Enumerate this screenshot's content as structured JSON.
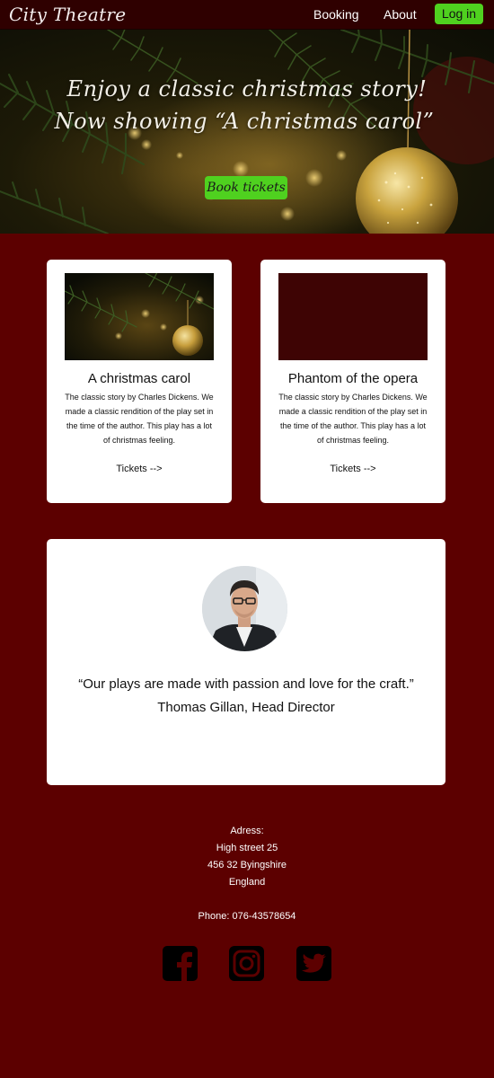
{
  "nav": {
    "logo": "City Theatre",
    "links": [
      "Booking",
      "About"
    ],
    "login_label": "Log in"
  },
  "hero": {
    "line1": "Enjoy a classic christmas story!",
    "line2": "Now showing “A christmas carol”",
    "cta_label": "Book tickets"
  },
  "cards": [
    {
      "title": "A christmas carol",
      "description": "The classic story by Charles Dickens. We made a classic rendition of the play set in the time of the author. This play has a lot of christmas feeling.",
      "link_label": "Tickets -->"
    },
    {
      "title": "Phantom of the opera",
      "description": "The classic story by Charles Dickens. We made a classic rendition of the play set in the time of the author. This play has a lot of christmas feeling.",
      "link_label": "Tickets -->"
    }
  ],
  "quote": {
    "text": "“Our plays are made with passion and love for the craft.”",
    "author": "Thomas Gillan, Head Director"
  },
  "footer": {
    "address_label": "Adress:",
    "address_lines": [
      "High  street 25",
      "456 32 Byingshire",
      "England"
    ],
    "phone": "Phone: 076-43578654",
    "social_icons": [
      "facebook-icon",
      "instagram-icon",
      "twitter-icon"
    ]
  },
  "colors": {
    "background": "#5c0000",
    "nav_background": "#2f0000",
    "accent_green": "#4fd11f",
    "card_background": "#ffffff"
  }
}
